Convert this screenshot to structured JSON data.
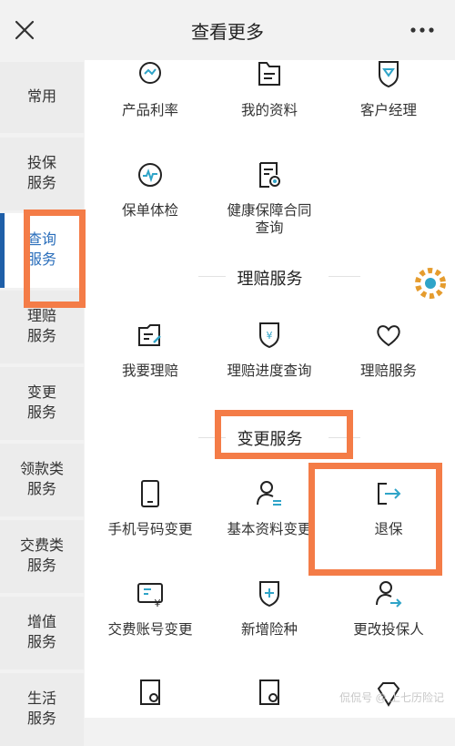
{
  "header": {
    "title": "查看更多",
    "close_icon": "close-icon",
    "more_icon": "more-icon"
  },
  "sidebar": {
    "items": [
      {
        "label": "常用"
      },
      {
        "label": "投保\n服务"
      },
      {
        "label": "查询\n服务",
        "active": true
      },
      {
        "label": "理赔\n服务"
      },
      {
        "label": "变更\n服务"
      },
      {
        "label": "领款类\n服务"
      },
      {
        "label": "交费类\n服务"
      },
      {
        "label": "增值\n服务"
      },
      {
        "label": "生活\n服务"
      }
    ]
  },
  "query": {
    "items": [
      {
        "label": "产品利率",
        "icon": "rate-icon"
      },
      {
        "label": "我的资料",
        "icon": "folder-icon"
      },
      {
        "label": "客户经理",
        "icon": "manager-shield-icon"
      },
      {
        "label": "保单体检",
        "icon": "health-check-icon"
      },
      {
        "label": "健康保障合同\n查询",
        "icon": "contract-search-icon"
      }
    ]
  },
  "claims": {
    "title": "理赔服务",
    "items": [
      {
        "label": "我要理赔",
        "icon": "claim-icon"
      },
      {
        "label": "理赔进度查询",
        "icon": "yen-shield-icon"
      },
      {
        "label": "理赔服务",
        "icon": "heart-icon"
      }
    ]
  },
  "change": {
    "title": "变更服务",
    "items": [
      {
        "label": "手机号码变更",
        "icon": "phone-icon"
      },
      {
        "label": "基本资料变更",
        "icon": "user-edit-icon"
      },
      {
        "label": "退保",
        "icon": "exit-icon"
      },
      {
        "label": "交费账号变更",
        "icon": "card-yen-icon"
      },
      {
        "label": "新增险种",
        "icon": "add-shield-icon"
      },
      {
        "label": "更改投保人",
        "icon": "user-switch-icon"
      }
    ]
  },
  "watermark": "侃侃号 @ 上七历险记",
  "colors": {
    "accent": "#2a6ebb",
    "indicator": "#1f5fa8",
    "highlight": "#f47c47",
    "icon_teal": "#2fa4c8"
  }
}
